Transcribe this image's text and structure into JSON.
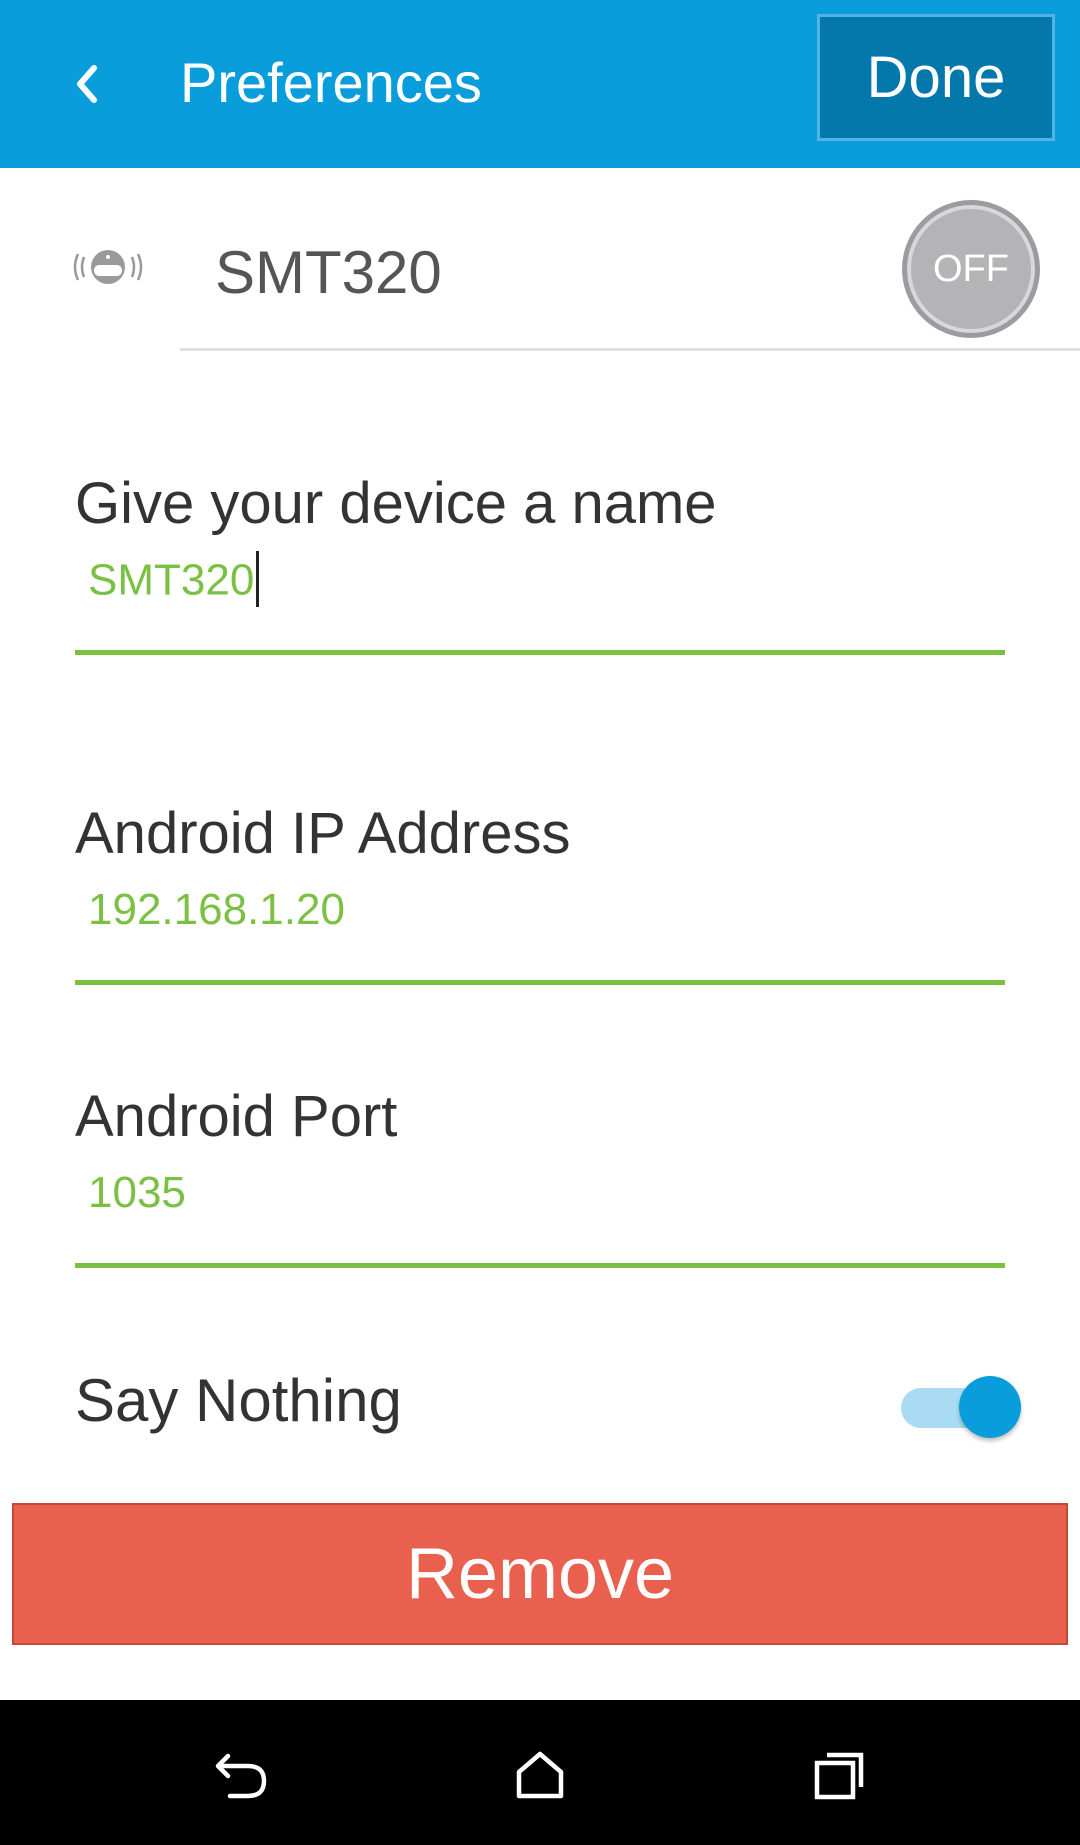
{
  "header": {
    "title": "Preferences",
    "done_label": "Done",
    "back_icon": "chevron-left-icon"
  },
  "device": {
    "name": "SMT320",
    "power_label": "OFF",
    "icon": "speaker-device-icon"
  },
  "fields": {
    "name": {
      "label": "Give your device a name",
      "value": "SMT320"
    },
    "ip": {
      "label": "Android IP Address",
      "value": "192.168.1.20"
    },
    "port": {
      "label": "Android Port",
      "value": "1035"
    }
  },
  "say_nothing": {
    "label": "Say Nothing",
    "enabled": true
  },
  "remove_label": "Remove",
  "navbar": {
    "back_icon": "nav-back-icon",
    "home_icon": "nav-home-icon",
    "recents_icon": "nav-recents-icon"
  },
  "colors": {
    "primary": "#0a9ddb",
    "done_bg": "#0478ab",
    "accent_green": "#7ac043",
    "danger": "#e9604e"
  }
}
